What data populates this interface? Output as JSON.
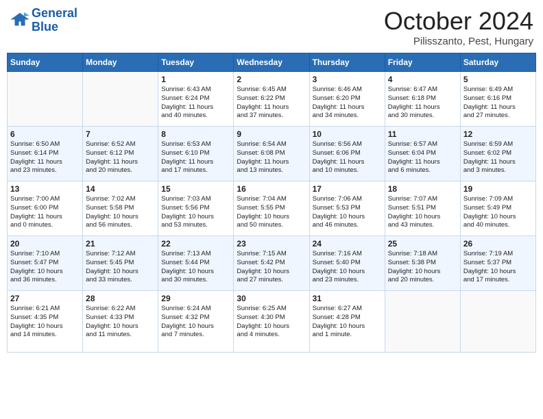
{
  "logo": {
    "line1": "General",
    "line2": "Blue"
  },
  "title": "October 2024",
  "location": "Pilisszanto, Pest, Hungary",
  "weekdays": [
    "Sunday",
    "Monday",
    "Tuesday",
    "Wednesday",
    "Thursday",
    "Friday",
    "Saturday"
  ],
  "weeks": [
    [
      {
        "day": "",
        "info": ""
      },
      {
        "day": "",
        "info": ""
      },
      {
        "day": "1",
        "info": "Sunrise: 6:43 AM\nSunset: 6:24 PM\nDaylight: 11 hours\nand 40 minutes."
      },
      {
        "day": "2",
        "info": "Sunrise: 6:45 AM\nSunset: 6:22 PM\nDaylight: 11 hours\nand 37 minutes."
      },
      {
        "day": "3",
        "info": "Sunrise: 6:46 AM\nSunset: 6:20 PM\nDaylight: 11 hours\nand 34 minutes."
      },
      {
        "day": "4",
        "info": "Sunrise: 6:47 AM\nSunset: 6:18 PM\nDaylight: 11 hours\nand 30 minutes."
      },
      {
        "day": "5",
        "info": "Sunrise: 6:49 AM\nSunset: 6:16 PM\nDaylight: 11 hours\nand 27 minutes."
      }
    ],
    [
      {
        "day": "6",
        "info": "Sunrise: 6:50 AM\nSunset: 6:14 PM\nDaylight: 11 hours\nand 23 minutes."
      },
      {
        "day": "7",
        "info": "Sunrise: 6:52 AM\nSunset: 6:12 PM\nDaylight: 11 hours\nand 20 minutes."
      },
      {
        "day": "8",
        "info": "Sunrise: 6:53 AM\nSunset: 6:10 PM\nDaylight: 11 hours\nand 17 minutes."
      },
      {
        "day": "9",
        "info": "Sunrise: 6:54 AM\nSunset: 6:08 PM\nDaylight: 11 hours\nand 13 minutes."
      },
      {
        "day": "10",
        "info": "Sunrise: 6:56 AM\nSunset: 6:06 PM\nDaylight: 11 hours\nand 10 minutes."
      },
      {
        "day": "11",
        "info": "Sunrise: 6:57 AM\nSunset: 6:04 PM\nDaylight: 11 hours\nand 6 minutes."
      },
      {
        "day": "12",
        "info": "Sunrise: 6:59 AM\nSunset: 6:02 PM\nDaylight: 11 hours\nand 3 minutes."
      }
    ],
    [
      {
        "day": "13",
        "info": "Sunrise: 7:00 AM\nSunset: 6:00 PM\nDaylight: 11 hours\nand 0 minutes."
      },
      {
        "day": "14",
        "info": "Sunrise: 7:02 AM\nSunset: 5:58 PM\nDaylight: 10 hours\nand 56 minutes."
      },
      {
        "day": "15",
        "info": "Sunrise: 7:03 AM\nSunset: 5:56 PM\nDaylight: 10 hours\nand 53 minutes."
      },
      {
        "day": "16",
        "info": "Sunrise: 7:04 AM\nSunset: 5:55 PM\nDaylight: 10 hours\nand 50 minutes."
      },
      {
        "day": "17",
        "info": "Sunrise: 7:06 AM\nSunset: 5:53 PM\nDaylight: 10 hours\nand 46 minutes."
      },
      {
        "day": "18",
        "info": "Sunrise: 7:07 AM\nSunset: 5:51 PM\nDaylight: 10 hours\nand 43 minutes."
      },
      {
        "day": "19",
        "info": "Sunrise: 7:09 AM\nSunset: 5:49 PM\nDaylight: 10 hours\nand 40 minutes."
      }
    ],
    [
      {
        "day": "20",
        "info": "Sunrise: 7:10 AM\nSunset: 5:47 PM\nDaylight: 10 hours\nand 36 minutes."
      },
      {
        "day": "21",
        "info": "Sunrise: 7:12 AM\nSunset: 5:45 PM\nDaylight: 10 hours\nand 33 minutes."
      },
      {
        "day": "22",
        "info": "Sunrise: 7:13 AM\nSunset: 5:44 PM\nDaylight: 10 hours\nand 30 minutes."
      },
      {
        "day": "23",
        "info": "Sunrise: 7:15 AM\nSunset: 5:42 PM\nDaylight: 10 hours\nand 27 minutes."
      },
      {
        "day": "24",
        "info": "Sunrise: 7:16 AM\nSunset: 5:40 PM\nDaylight: 10 hours\nand 23 minutes."
      },
      {
        "day": "25",
        "info": "Sunrise: 7:18 AM\nSunset: 5:38 PM\nDaylight: 10 hours\nand 20 minutes."
      },
      {
        "day": "26",
        "info": "Sunrise: 7:19 AM\nSunset: 5:37 PM\nDaylight: 10 hours\nand 17 minutes."
      }
    ],
    [
      {
        "day": "27",
        "info": "Sunrise: 6:21 AM\nSunset: 4:35 PM\nDaylight: 10 hours\nand 14 minutes."
      },
      {
        "day": "28",
        "info": "Sunrise: 6:22 AM\nSunset: 4:33 PM\nDaylight: 10 hours\nand 11 minutes."
      },
      {
        "day": "29",
        "info": "Sunrise: 6:24 AM\nSunset: 4:32 PM\nDaylight: 10 hours\nand 7 minutes."
      },
      {
        "day": "30",
        "info": "Sunrise: 6:25 AM\nSunset: 4:30 PM\nDaylight: 10 hours\nand 4 minutes."
      },
      {
        "day": "31",
        "info": "Sunrise: 6:27 AM\nSunset: 4:28 PM\nDaylight: 10 hours\nand 1 minute."
      },
      {
        "day": "",
        "info": ""
      },
      {
        "day": "",
        "info": ""
      }
    ]
  ]
}
